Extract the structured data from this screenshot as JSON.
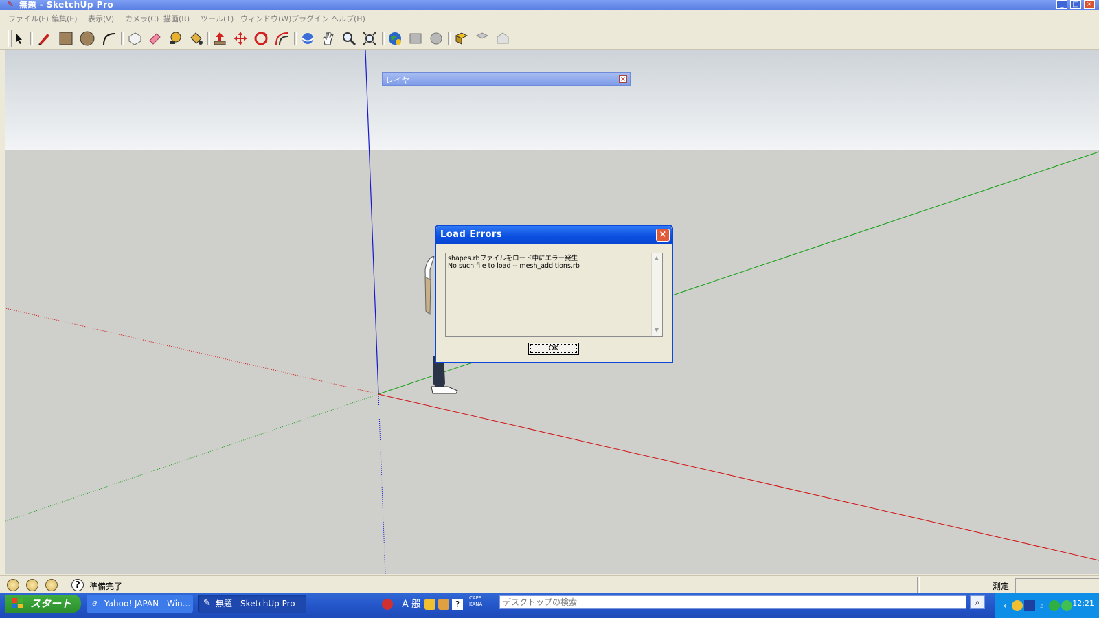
{
  "window": {
    "title": "無題 - SketchUp Pro",
    "buttons": {
      "minimize": "_",
      "maximize": "□",
      "close": "×"
    }
  },
  "menubar": {
    "items": [
      "ファイル(F)",
      "編集(E)",
      "表示(V)",
      "カメラ(C)",
      "描画(R)",
      "ツール(T)",
      "ウィンドウ(W)",
      "プラグイン",
      "ヘルプ(H)"
    ]
  },
  "toolbar": {
    "tools": [
      "select",
      "pencil",
      "rectangle",
      "circle",
      "arc",
      "make-component",
      "eraser",
      "tape-measure",
      "paint-bucket",
      "push-pull",
      "move",
      "rotate",
      "offset",
      "orbit",
      "pan",
      "zoom",
      "zoom-extents",
      "3d-warehouse",
      "share-model",
      "get-photo-texture",
      "components",
      "share-component",
      "google-earth"
    ]
  },
  "layer_panel": {
    "title": "レイヤ",
    "close": "×"
  },
  "dialog": {
    "title": "Load Errors",
    "close": "×",
    "message_line1": "shapes.rbファイルをロード中にエラー発生",
    "message_line2": "No such file to load -- mesh_additions.rb",
    "ok_label": "OK"
  },
  "statusbar": {
    "help": "?",
    "status_text": "準備完了",
    "measure_label": "測定",
    "measure_value": ""
  },
  "taskbar": {
    "start_label": "スタート",
    "tasks": [
      {
        "label": "Yahoo! JAPAN - Win..."
      },
      {
        "label": "無題 - SketchUp Pro"
      }
    ],
    "ime_a": "A",
    "ime_mode": "般",
    "caps": "CAPS",
    "kana": "KANA",
    "search_placeholder": "デスクトップの検索",
    "clock": "12:21"
  },
  "colors": {
    "red_axis": "#d01010",
    "green_axis": "#10a010",
    "blue_axis": "#1818d0",
    "dialog_title": "#0a4fe0",
    "taskbar": "#2456c9"
  }
}
